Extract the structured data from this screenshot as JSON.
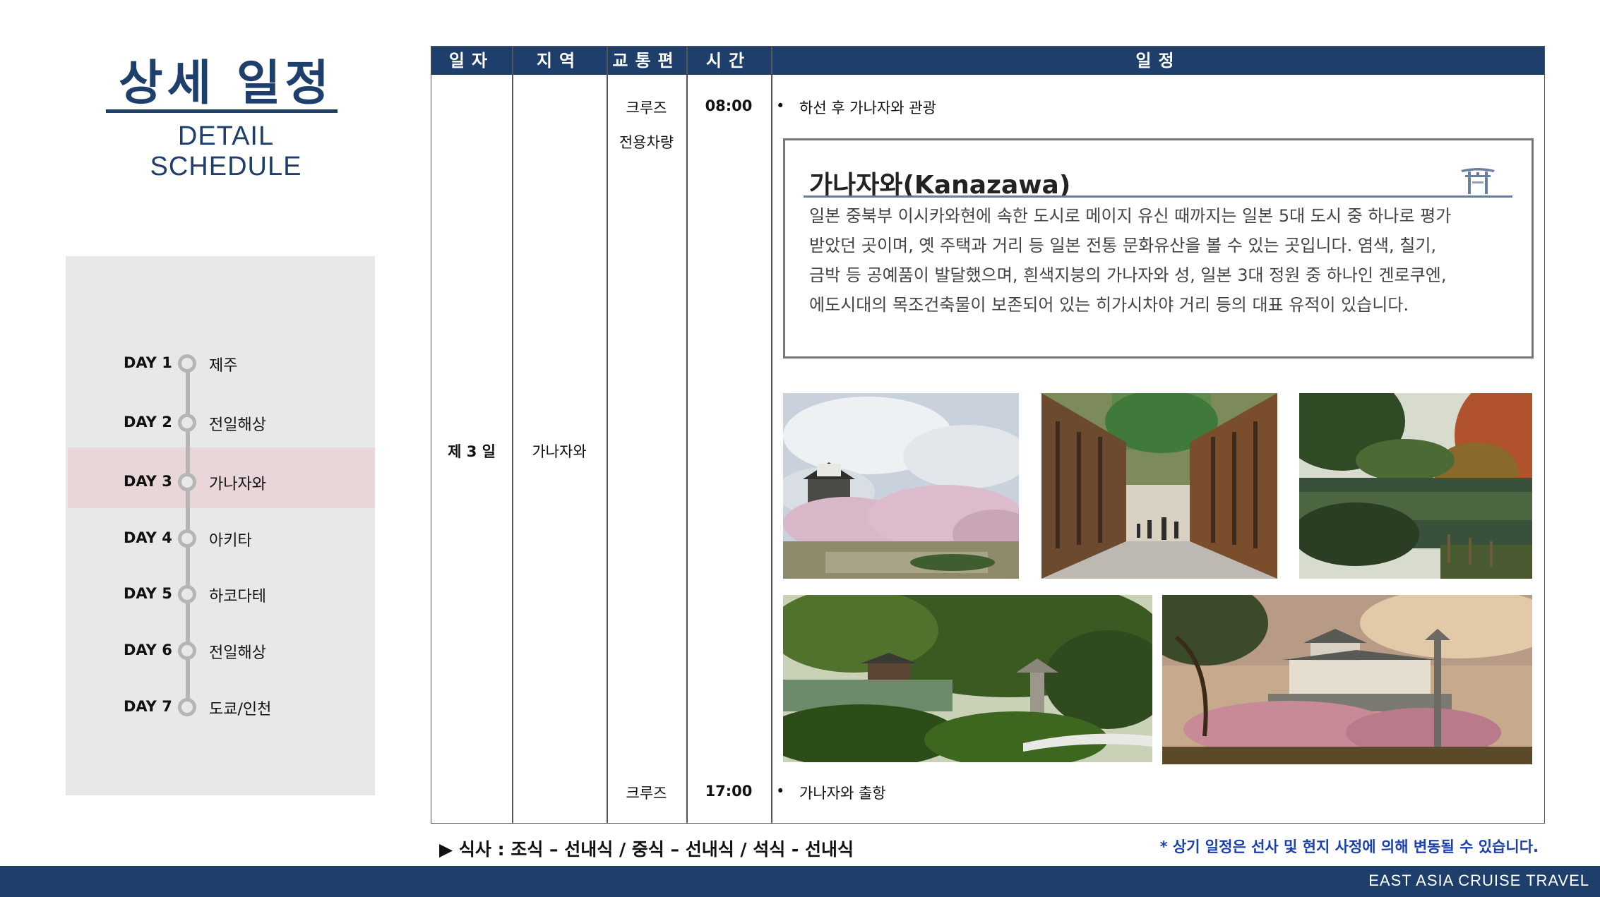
{
  "header": {
    "title_ko": "상세 일정",
    "title_en": "DETAIL SCHEDULE"
  },
  "days": [
    {
      "label": "DAY 1",
      "place": "제주"
    },
    {
      "label": "DAY 2",
      "place": "전일해상"
    },
    {
      "label": "DAY 3",
      "place": "가나자와",
      "active": true
    },
    {
      "label": "DAY 4",
      "place": "아키타"
    },
    {
      "label": "DAY 5",
      "place": "하코다테"
    },
    {
      "label": "DAY 6",
      "place": "전일해상"
    },
    {
      "label": "DAY 7",
      "place": "도쿄/인천"
    }
  ],
  "table": {
    "headers": [
      "일자",
      "지역",
      "교통편",
      "시간",
      "일정"
    ],
    "day": "제 3 일",
    "region": "가나자와",
    "rows": [
      {
        "transport": "크루즈",
        "time": "08:00",
        "plan": "하선 후 가나자와 관광"
      },
      {
        "transport": "전용차량",
        "time": "",
        "plan": ""
      },
      {
        "transport": "크루즈",
        "time": "17:00",
        "plan": "가나자와 출항"
      }
    ],
    "bullet": "•"
  },
  "info": {
    "title": "가나자와(Kanazawa)",
    "lines": [
      "일본 중북부 이시카와현에 속한 도시로 메이지 유신 때까지는 일본 5대 도시 중 하나로 평가",
      "받았던 곳이며, 옛 주택과 거리 등 일본 전통 문화유산을 볼 수 있는 곳입니다. 염색, 칠기,",
      "금박 등 공예품이 발달했으며, 흰색지붕의 가나자와 성, 일본 3대 정원 중 하나인 겐로쿠엔,",
      "에도시대의 목조건축물이 보존되어 있는 히가시차야 거리 등의 대표 유적이 있습니다."
    ],
    "icon": "torii-gate-icon"
  },
  "photos": [
    {
      "icon": "castle-cherry-blossom-photo"
    },
    {
      "icon": "chaya-street-photo"
    },
    {
      "icon": "garden-pond-photo"
    },
    {
      "icon": "kenrokuen-garden-photo"
    },
    {
      "icon": "castle-sunset-photo"
    }
  ],
  "footer": {
    "meal": "▶ 식사 : 조식 – 선내식 / 중식 – 선내식 / 석식 - 선내식",
    "note": "* 상기 일정은 선사 및 현지 사정에 의해 변동될 수 있습니다.",
    "brand": "EAST ASIA CRUISE TRAVEL"
  },
  "colors": {
    "navy": "#1e3f6b",
    "panel": "#e8e8e8",
    "highlight": "#e8d6d8",
    "note_blue": "#1a3fae"
  }
}
